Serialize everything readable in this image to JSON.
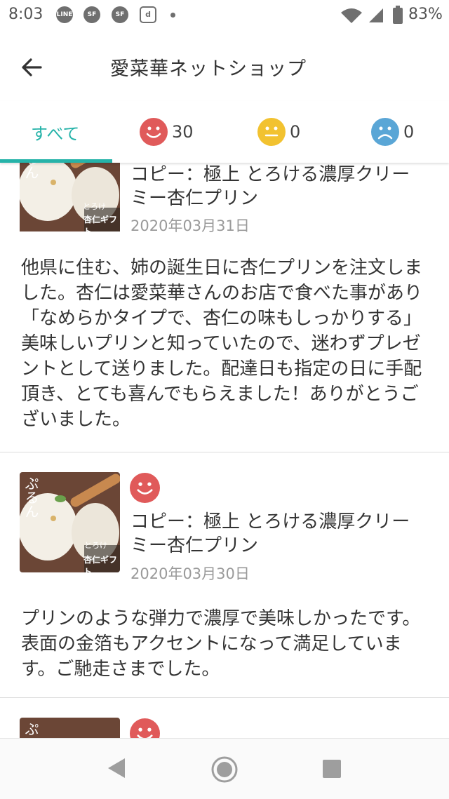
{
  "status_bar": {
    "time": "8:03",
    "icons": [
      "line-icon",
      "sf-icon",
      "sf-icon",
      "d-icon"
    ],
    "battery": "83%"
  },
  "app_bar": {
    "title": "愛菜華ネットショップ"
  },
  "tabs": [
    {
      "label": "すべて",
      "selected": true
    },
    {
      "icon": "smile-face-icon",
      "count": "30",
      "color": "#e05a5a"
    },
    {
      "icon": "neutral-face-icon",
      "count": "0",
      "color": "#f2c230"
    },
    {
      "icon": "sad-face-icon",
      "count": "0",
      "color": "#5aa6d6"
    }
  ],
  "accent_color": "#26b3a9",
  "reviews": [
    {
      "thumb_text_1": "とろけ",
      "thumb_text_2": "杏仁ギフト",
      "thumb_side": "るん",
      "title": "コピー：極上 とろける濃厚クリーミー杏仁プリン",
      "date": "2020年03月31日",
      "body": "他県に住む、姉の誕生日に杏仁プリンを注文しました。杏仁は愛菜華さんのお店で食べた事があり「なめらかタイプで、杏仁の味もしっかりする」美味しいプリンと知っていたので、迷わずプレゼントとして送りました。配達日も指定の日に手配頂き、とても喜んでもらえました！ありがとうございました。"
    },
    {
      "thumb_text_1": "とろけ",
      "thumb_text_2": "杏仁ギフト",
      "thumb_side": "ぷるん",
      "rating": "smile-face-icon",
      "title": "コピー：極上 とろける濃厚クリーミー杏仁プリン",
      "date": "2020年03月30日",
      "body": "プリンのような弾力で濃厚で美味しかったです。表面の金箔もアクセントになって満足しています。ご馳走さまでした。"
    },
    {
      "thumb_side": "ぷ",
      "rating": "smile-face-icon"
    }
  ],
  "nav_bar": [
    "back-triangle-icon",
    "home-circle-icon",
    "recents-square-icon"
  ]
}
